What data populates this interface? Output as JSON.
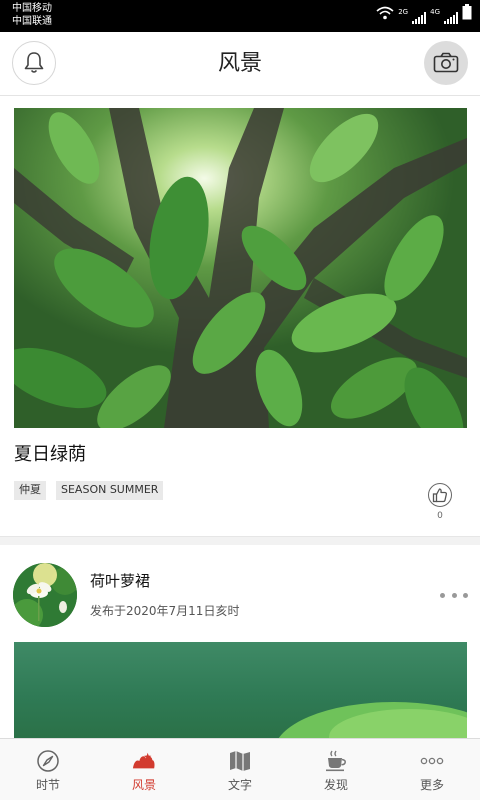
{
  "status_bar": {
    "carrier_1": "中国移动",
    "carrier_2": "中国联通",
    "net_1": "2G",
    "net_2": "4G"
  },
  "header": {
    "title": "风景",
    "left_icon": "bell-icon",
    "right_icon": "camera-icon"
  },
  "card1": {
    "title": "夏日绿荫",
    "tags": [
      "仲夏",
      "SEASON SUMMER"
    ],
    "like_count": "0",
    "like_icon": "thumbs-up-icon"
  },
  "card2": {
    "author": "荷叶萝裙",
    "date": "发布于2020年7月11日亥时",
    "more_icon": "more-dots-icon"
  },
  "nav": {
    "items": [
      {
        "label": "时节",
        "icon": "compass-icon"
      },
      {
        "label": "风景",
        "icon": "landscape-icon"
      },
      {
        "label": "文字",
        "icon": "map-icon"
      },
      {
        "label": "发现",
        "icon": "coffee-cup-icon"
      },
      {
        "label": "更多",
        "icon": "more-dots-icon"
      }
    ],
    "active_index": 1
  },
  "colors": {
    "accent": "#d23b2f",
    "header_bg": "#ffffff",
    "status_bar_bg": "#000000"
  }
}
